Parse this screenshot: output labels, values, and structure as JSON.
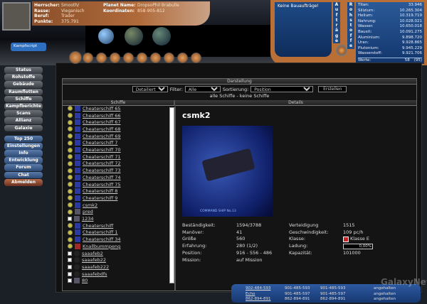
{
  "header": {
    "fields": [
      {
        "label": "Herrscher:",
        "value": "Smooth/"
      },
      {
        "label": "Rasse:",
        "value": "Vieganisch"
      },
      {
        "label": "Beruf:",
        "value": "Trader"
      },
      {
        "label": "Punkte:",
        "value": "375.791"
      }
    ],
    "planet": [
      {
        "label": "Planet Name:",
        "value": "DropsoPhil Brabulle"
      },
      {
        "label": "Koordinaten:",
        "value": "858-905-812"
      }
    ]
  },
  "bauauftraege": {
    "text": "Keine Bauaufträge!",
    "label": "Aufträge"
  },
  "rohstoffe": {
    "label": "Rohstoffe",
    "items": [
      {
        "name": "Titan:",
        "value": "33.946"
      },
      {
        "name": "Silizium:",
        "value": "10.265.304"
      },
      {
        "name": "Helium:",
        "value": "10.319.719"
      },
      {
        "name": "Nahrung:",
        "value": "10.028.021"
      },
      {
        "name": "Wasser:",
        "value": "10.650.018"
      },
      {
        "name": "Bauxit:",
        "value": "10.091.275"
      },
      {
        "name": "Aluminium:",
        "value": "9.898.720"
      },
      {
        "name": "Uran:",
        "value": "9.928.865"
      },
      {
        "name": "Plutonium:",
        "value": "9.945.229"
      },
      {
        "name": "Wasserstoff:",
        "value": "9.921.706"
      }
    ],
    "werte_label": "Werte:",
    "werte": "58",
    "werte_extra": "(95)",
    "credits_label": "Credits:",
    "credits": "4.551.555.278"
  },
  "kampfscript": "Kampfscript",
  "nav": {
    "group1": [
      "Status",
      "Rohstoffe",
      "Gebäude",
      "Raumflotten",
      "Schiffe",
      "Kampfberichte",
      "Scans",
      "Allianz",
      "Galaxie"
    ],
    "group2": [
      "Top 250",
      "Einstellungen",
      "Info",
      "Entwicklung",
      "Forum",
      "Chat"
    ],
    "logout": "Abmelden"
  },
  "darstellung": {
    "title": "Darstellung",
    "view": "Detailiert",
    "filter_label": "Filter:",
    "filter": "Alle",
    "sort_label": "Sortierung:",
    "sort": "Position",
    "create": "Erstellen",
    "summary": "alle Schiffe - keine Schiffe"
  },
  "columns": {
    "ships": "Schiffe",
    "details": "Details"
  },
  "ships": [
    {
      "name": "Cheaterschiff 65",
      "mark": "gear",
      "thumb": "b"
    },
    {
      "name": "Cheaterschiff 66",
      "mark": "gear",
      "thumb": "b"
    },
    {
      "name": "Cheaterschiff 67",
      "mark": "gear",
      "thumb": "b"
    },
    {
      "name": "Cheaterschiff 68",
      "mark": "gear",
      "thumb": "b"
    },
    {
      "name": "Cheaterschiff 69",
      "mark": "gear",
      "thumb": "b"
    },
    {
      "name": "Cheaterschiff 7",
      "mark": "gear",
      "thumb": "b"
    },
    {
      "name": "Cheaterschiff 70",
      "mark": "gear",
      "thumb": "b"
    },
    {
      "name": "Cheaterschiff 71",
      "mark": "gear",
      "thumb": "b"
    },
    {
      "name": "Cheaterschiff 72",
      "mark": "gear",
      "thumb": "b"
    },
    {
      "name": "Cheaterschiff 73",
      "mark": "gear",
      "thumb": "b"
    },
    {
      "name": "Cheaterschiff 74",
      "mark": "gear",
      "thumb": "b"
    },
    {
      "name": "Cheaterschiff 75",
      "mark": "gear",
      "thumb": "b"
    },
    {
      "name": "Cheaterschiff 8",
      "mark": "gear",
      "thumb": "b"
    },
    {
      "name": "Cheaterschiff 9",
      "mark": "gear",
      "thumb": "b"
    },
    {
      "name": "csmk2",
      "mark": "gear",
      "thumb": "b"
    },
    {
      "name": "pred",
      "mark": "gear",
      "thumb": "g"
    },
    {
      "name": "1234",
      "mark": "chk",
      "thumb": "g"
    },
    {
      "name": "Cheaterschiff",
      "mark": "gear",
      "thumb": "b"
    },
    {
      "name": "Cheaterschiff 1",
      "mark": "gear",
      "thumb": "b"
    },
    {
      "name": "Cheaterschiff 34",
      "mark": "gear",
      "thumb": "b"
    },
    {
      "name": "Knallbummpeng",
      "mark": "gear",
      "thumb": "r"
    },
    {
      "name": "saaafeb2",
      "mark": "chk",
      "thumb": "d"
    },
    {
      "name": "saaafeb22",
      "mark": "chk",
      "thumb": "d"
    },
    {
      "name": "saaafeb222",
      "mark": "chk",
      "thumb": "d"
    },
    {
      "name": "saaafebdfs",
      "mark": "chk",
      "thumb": "d"
    },
    {
      "name": "80",
      "mark": "chk",
      "thumb": "g"
    }
  ],
  "details": {
    "title": "csmk2",
    "image_caption": "COMMAND SHIP No.13",
    "left": [
      {
        "label": "Beständigkeit:",
        "value": "1594/3788"
      },
      {
        "label": "Manöver:",
        "value": "41"
      },
      {
        "label": "Größe",
        "value": "560"
      },
      {
        "label": "Erfahrung:",
        "value": "280 (1/2)"
      },
      {
        "label": "Position:",
        "value": "916 - 556 - 486"
      },
      {
        "label": "Mission:",
        "value": "auf Mission"
      }
    ],
    "right": [
      {
        "label": "Verteidigung",
        "value": "1515"
      },
      {
        "label": "Geschwindigkeit:",
        "value": "109 pc/h"
      },
      {
        "label": "Klasse:",
        "value": "Klasse E"
      },
      {
        "label": "Ladung:",
        "value": "0,00%"
      },
      {
        "label": "Kapazität:",
        "value": "101000"
      }
    ],
    "ladung_fraction": 0.0
  },
  "fleet_bar": {
    "rows": [
      [
        "902-484-593",
        "901-485-593",
        "901-485-593",
        "angehalten"
      ],
      [
        "Echo",
        "901-485-597",
        "901-485-597",
        "angehalten"
      ],
      [
        "862-894-891",
        "862-894-891",
        "862-894-891",
        "angehalten"
      ]
    ]
  },
  "watermark": "GalaxyNews"
}
